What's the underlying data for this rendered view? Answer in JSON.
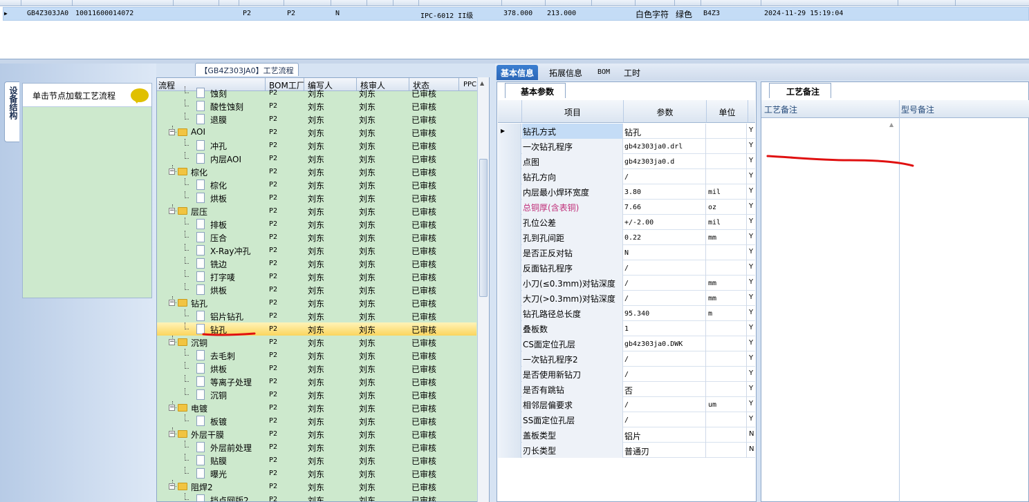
{
  "top_grid": {
    "row": {
      "code": "GB4Z303JA0",
      "id": "10011600014072",
      "f1": "P2",
      "f2": "P2",
      "f3": "N",
      "standard": "IPC-6012 II级",
      "v1": "378.000",
      "v2": "213.000",
      "char_color": "白色字符",
      "solder_color": "绿色",
      "layer": "B4Z3",
      "datetime": "2024-11-29 15:19:04"
    }
  },
  "left_panel": {
    "vertical_tab": "设备结构",
    "node_hint": "单击节点加载工艺流程"
  },
  "flow": {
    "tab_title": "【GB4Z303JA0】工艺流程",
    "columns": [
      "流程",
      "BOM工厂",
      "编写人",
      "核审人",
      "状态",
      "PPC"
    ],
    "rows": [
      {
        "level": 2,
        "type": "file",
        "name": "蚀刻",
        "bom": "P2",
        "writer": "刘东",
        "reviewer": "刘东",
        "status": "已审核"
      },
      {
        "level": 2,
        "type": "file",
        "name": "酸性蚀刻",
        "bom": "P2",
        "writer": "刘东",
        "reviewer": "刘东",
        "status": "已审核"
      },
      {
        "level": 2,
        "type": "file",
        "name": "退膜",
        "bom": "P2",
        "writer": "刘东",
        "reviewer": "刘东",
        "status": "已审核"
      },
      {
        "level": 1,
        "type": "folder",
        "name": "AOI",
        "bom": "P2",
        "writer": "刘东",
        "reviewer": "刘东",
        "status": "已审核"
      },
      {
        "level": 2,
        "type": "file",
        "name": "冲孔",
        "bom": "P2",
        "writer": "刘东",
        "reviewer": "刘东",
        "status": "已审核"
      },
      {
        "level": 2,
        "type": "file",
        "name": "内层AOI",
        "bom": "P2",
        "writer": "刘东",
        "reviewer": "刘东",
        "status": "已审核"
      },
      {
        "level": 1,
        "type": "folder",
        "name": "棕化",
        "bom": "P2",
        "writer": "刘东",
        "reviewer": "刘东",
        "status": "已审核"
      },
      {
        "level": 2,
        "type": "file",
        "name": "棕化",
        "bom": "P2",
        "writer": "刘东",
        "reviewer": "刘东",
        "status": "已审核"
      },
      {
        "level": 2,
        "type": "file",
        "name": "烘板",
        "bom": "P2",
        "writer": "刘东",
        "reviewer": "刘东",
        "status": "已审核"
      },
      {
        "level": 1,
        "type": "folder",
        "name": "层压",
        "bom": "P2",
        "writer": "刘东",
        "reviewer": "刘东",
        "status": "已审核"
      },
      {
        "level": 2,
        "type": "file",
        "name": "排板",
        "bom": "P2",
        "writer": "刘东",
        "reviewer": "刘东",
        "status": "已审核"
      },
      {
        "level": 2,
        "type": "file",
        "name": "压合",
        "bom": "P2",
        "writer": "刘东",
        "reviewer": "刘东",
        "status": "已审核"
      },
      {
        "level": 2,
        "type": "file",
        "name": "X-Ray冲孔",
        "bom": "P2",
        "writer": "刘东",
        "reviewer": "刘东",
        "status": "已审核"
      },
      {
        "level": 2,
        "type": "file",
        "name": "铣边",
        "bom": "P2",
        "writer": "刘东",
        "reviewer": "刘东",
        "status": "已审核"
      },
      {
        "level": 2,
        "type": "file",
        "name": "打字唛",
        "bom": "P2",
        "writer": "刘东",
        "reviewer": "刘东",
        "status": "已审核"
      },
      {
        "level": 2,
        "type": "file",
        "name": "烘板",
        "bom": "P2",
        "writer": "刘东",
        "reviewer": "刘东",
        "status": "已审核"
      },
      {
        "level": 1,
        "type": "folder",
        "name": "钻孔",
        "bom": "P2",
        "writer": "刘东",
        "reviewer": "刘东",
        "status": "已审核"
      },
      {
        "level": 2,
        "type": "file",
        "name": "铝片钻孔",
        "bom": "P2",
        "writer": "刘东",
        "reviewer": "刘东",
        "status": "已审核"
      },
      {
        "level": 2,
        "type": "file",
        "name": "钻孔",
        "bom": "P2",
        "writer": "刘东",
        "reviewer": "刘东",
        "status": "已审核",
        "selected": true
      },
      {
        "level": 1,
        "type": "folder",
        "name": "沉铜",
        "bom": "P2",
        "writer": "刘东",
        "reviewer": "刘东",
        "status": "已审核"
      },
      {
        "level": 2,
        "type": "file",
        "name": "去毛刺",
        "bom": "P2",
        "writer": "刘东",
        "reviewer": "刘东",
        "status": "已审核"
      },
      {
        "level": 2,
        "type": "file",
        "name": "烘板",
        "bom": "P2",
        "writer": "刘东",
        "reviewer": "刘东",
        "status": "已审核"
      },
      {
        "level": 2,
        "type": "file",
        "name": "等离子处理",
        "bom": "P2",
        "writer": "刘东",
        "reviewer": "刘东",
        "status": "已审核"
      },
      {
        "level": 2,
        "type": "file",
        "name": "沉铜",
        "bom": "P2",
        "writer": "刘东",
        "reviewer": "刘东",
        "status": "已审核"
      },
      {
        "level": 1,
        "type": "folder",
        "name": "电镀",
        "bom": "P2",
        "writer": "刘东",
        "reviewer": "刘东",
        "status": "已审核"
      },
      {
        "level": 2,
        "type": "file",
        "name": "板镀",
        "bom": "P2",
        "writer": "刘东",
        "reviewer": "刘东",
        "status": "已审核"
      },
      {
        "level": 1,
        "type": "folder",
        "name": "外层干膜",
        "bom": "P2",
        "writer": "刘东",
        "reviewer": "刘东",
        "status": "已审核"
      },
      {
        "level": 2,
        "type": "file",
        "name": "外层前处理",
        "bom": "P2",
        "writer": "刘东",
        "reviewer": "刘东",
        "status": "已审核"
      },
      {
        "level": 2,
        "type": "file",
        "name": "贴膜",
        "bom": "P2",
        "writer": "刘东",
        "reviewer": "刘东",
        "status": "已审核"
      },
      {
        "level": 2,
        "type": "file",
        "name": "曝光",
        "bom": "P2",
        "writer": "刘东",
        "reviewer": "刘东",
        "status": "已审核"
      },
      {
        "level": 1,
        "type": "folder",
        "name": "阻焊2",
        "bom": "P2",
        "writer": "刘东",
        "reviewer": "刘东",
        "status": "已审核"
      },
      {
        "level": 2,
        "type": "file",
        "name": "挡点网版2",
        "bom": "P2",
        "writer": "刘东",
        "reviewer": "刘东",
        "status": "已审核"
      }
    ]
  },
  "right_tabs": [
    "基本信息",
    "拓展信息",
    "BOM",
    "工时"
  ],
  "basic": {
    "tab": "基本参数",
    "headers": [
      "项目",
      "参数",
      "单位"
    ],
    "rows": [
      {
        "k": "钻孔方式",
        "v": "钻孔",
        "u": "",
        "y": "Y",
        "current": true
      },
      {
        "k": "一次钻孔程序",
        "v": "gb4z303ja0.drl",
        "u": "",
        "y": "Y"
      },
      {
        "k": "点图",
        "v": "gb4z303ja0.d",
        "u": "",
        "y": "Y"
      },
      {
        "k": "钻孔方向",
        "v": "/",
        "u": "",
        "y": "Y"
      },
      {
        "k": "内层最小焊环宽度",
        "v": "3.80",
        "u": "mil",
        "y": "Y"
      },
      {
        "k": "总铜厚(含表铜)",
        "v": "7.66",
        "u": "oz",
        "y": "Y",
        "highlight": true
      },
      {
        "k": "孔位公差",
        "v": "+/-2.00",
        "u": "mil",
        "y": "Y"
      },
      {
        "k": "孔到孔间距",
        "v": "0.22",
        "u": "mm",
        "y": "Y"
      },
      {
        "k": "是否正反对钻",
        "v": "N",
        "u": "",
        "y": "Y"
      },
      {
        "k": "反面钻孔程序",
        "v": "/",
        "u": "",
        "y": "Y"
      },
      {
        "k": "小刀(≤0.3mm)对钻深度",
        "v": "/",
        "u": "mm",
        "y": "Y"
      },
      {
        "k": "大刀(>0.3mm)对钻深度",
        "v": "/",
        "u": "mm",
        "y": "Y"
      },
      {
        "k": "钻孔路径总长度",
        "v": "95.340",
        "u": "m",
        "y": "Y"
      },
      {
        "k": "叠板数",
        "v": "1",
        "u": "",
        "y": "Y"
      },
      {
        "k": "CS面定位孔层",
        "v": "gb4z303ja0.DWK",
        "u": "",
        "y": "Y"
      },
      {
        "k": "一次钻孔程序2",
        "v": "/",
        "u": "",
        "y": "Y"
      },
      {
        "k": "是否使用新钻刀",
        "v": "/",
        "u": "",
        "y": "Y"
      },
      {
        "k": "是否有跳钻",
        "v": "否",
        "u": "",
        "y": "Y"
      },
      {
        "k": "相邻层偏要求",
        "v": "/",
        "u": "um",
        "y": "Y"
      },
      {
        "k": "SS面定位孔层",
        "v": "/",
        "u": "",
        "y": "Y"
      },
      {
        "k": "盖板类型",
        "v": "铝片",
        "u": "",
        "y": "N"
      },
      {
        "k": "刃长类型",
        "v": "普通刃",
        "u": "",
        "y": "N"
      }
    ]
  },
  "remark": {
    "tab": "工艺备注",
    "col1": "工艺备注",
    "col2": "型号备注"
  },
  "colors": {
    "tree_bg": "#cde9cd",
    "selected_row": "#fbd55d",
    "tab_active": "#2b66b7",
    "highlight_text": "#c0307a",
    "annotation_red": "#e01010"
  }
}
